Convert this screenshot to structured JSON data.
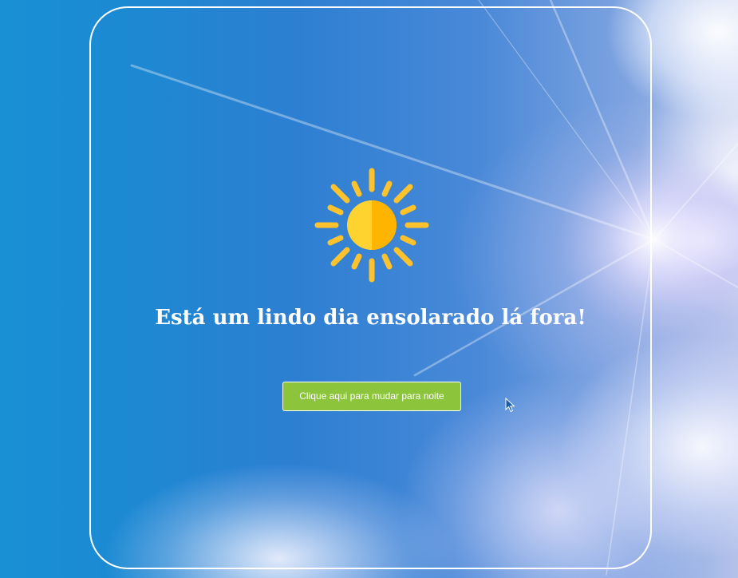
{
  "scene": {
    "background": "sunny-sky",
    "card_border_color": "#ffffff"
  },
  "weather": {
    "icon": "sun-icon",
    "sun_color": "#fec22c",
    "sun_shade_color": "#ffb400",
    "message": "Está um lindo dia ensolarado lá fora!"
  },
  "toggle": {
    "label": "Clique aqui para mudar para noite",
    "color": "#8cc43c"
  },
  "pointer": {
    "icon": "mouse-cursor-icon"
  }
}
